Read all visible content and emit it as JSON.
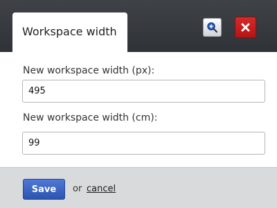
{
  "dialog": {
    "tab_title": "Workspace width"
  },
  "header": {
    "zoom_icon": "zoom-in-icon",
    "close_icon": "close-icon",
    "close_color": "#c21d1d"
  },
  "form": {
    "px_label": "New workspace width (px):",
    "px_value": "495",
    "cm_label": "New workspace width (cm):",
    "cm_value": "99"
  },
  "footer": {
    "save_label": "Save",
    "or_text": "or",
    "cancel_label": "cancel",
    "save_color": "#3a63c4"
  }
}
